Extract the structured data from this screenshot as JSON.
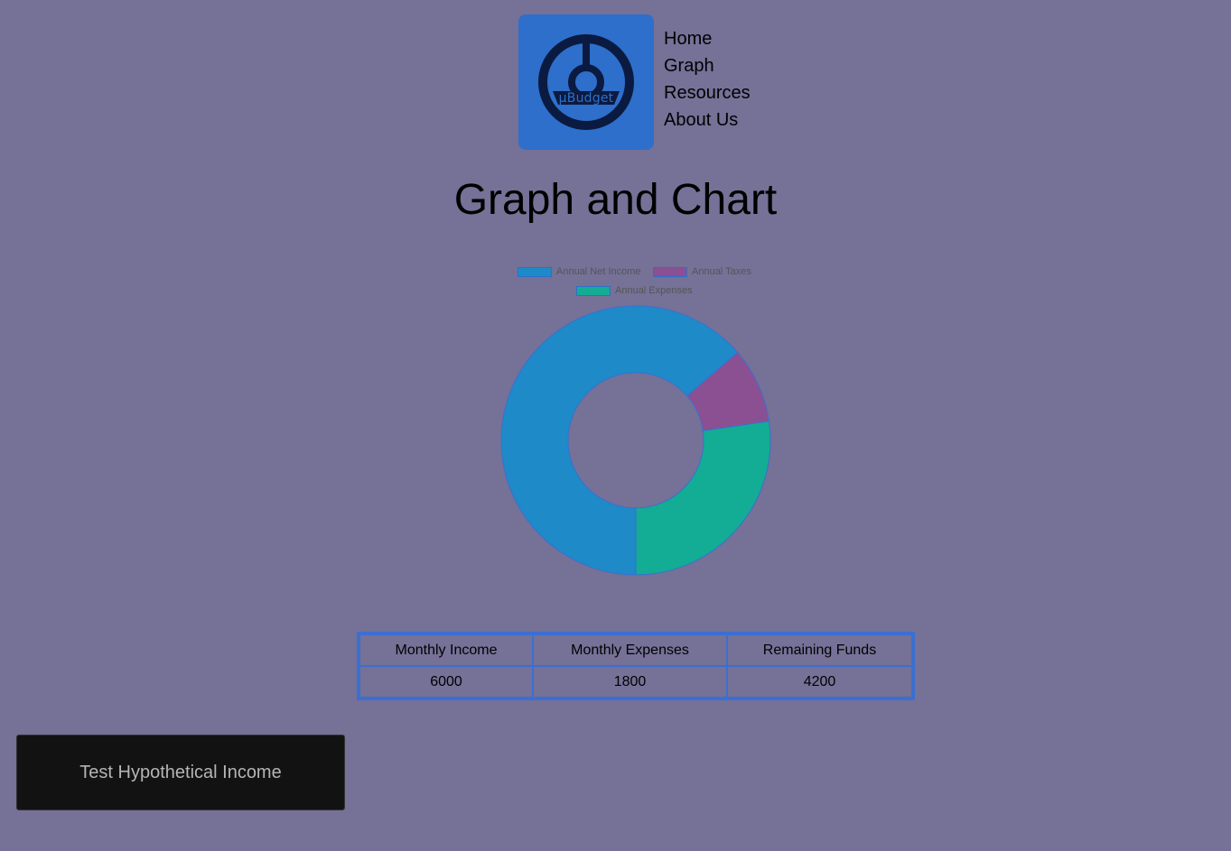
{
  "logo": {
    "text": "µBudget"
  },
  "nav": {
    "items": [
      "Home",
      "Graph",
      "Resources",
      "About Us"
    ]
  },
  "page": {
    "title": "Graph and Chart"
  },
  "chart_data": {
    "type": "pie",
    "style": "doughnut",
    "labels": [
      "Annual Net Income",
      "Annual Taxes",
      "Annual Expenses"
    ],
    "values": [
      50400,
      7200,
      21600
    ],
    "colors": [
      "#1e8ac7",
      "#8a5092",
      "#12ad94"
    ],
    "legend": "top"
  },
  "summary_table": {
    "headers": [
      "Monthly Income",
      "Monthly Expenses",
      "Remaining Funds"
    ],
    "rows": [
      [
        "6000",
        "1800",
        "4200"
      ]
    ]
  },
  "buttons": {
    "test_income": "Test Hypothetical Income"
  }
}
